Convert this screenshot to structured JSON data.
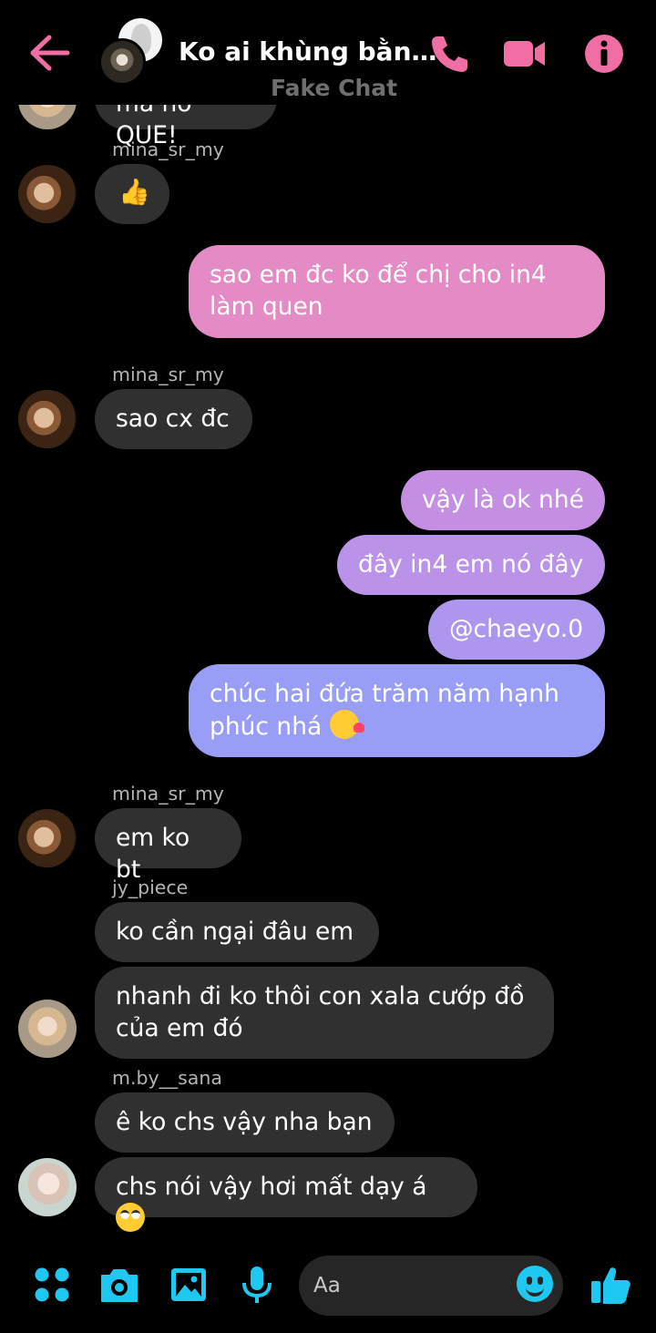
{
  "header": {
    "title": "Ko ai khùng bằn…",
    "subtitle": "Fake Chat",
    "icons": [
      "back-arrow-icon",
      "phone-icon",
      "video-icon",
      "info-icon"
    ],
    "accent_color": "#f06ea4"
  },
  "messages": {
    "clipped_top": "mà nó QUE!",
    "m1_sender": "mina_sr_my",
    "m1_emoji": "👍",
    "m2_text": "sao em đc ko để chị cho in4 làm quen",
    "m3_sender": "mina_sr_my",
    "m3_text": "sao cx đc",
    "m4_text": "vậy là ok nhé",
    "m5_text": "đây in4 em nó đây",
    "m6_text": "@chaeyo.0",
    "m7_text": "chúc hai đứa trăm năm hạnh phúc nhá",
    "m8_sender": "mina_sr_my",
    "m8_text": "em ko bt",
    "m9_sender": "jy_piece",
    "m9_text": "ko cần ngại đâu em",
    "m10_text": "nhanh đi ko thôi con xala cướp đồ của em đó",
    "m11_sender": "m.by__sana",
    "m11_text": "ê ko chs vậy nha bạn",
    "m12_text": "chs nói vậy hơi mất dạy á"
  },
  "composer": {
    "placeholder": "Aa",
    "icons": [
      "menu-dots-icon",
      "camera-icon",
      "image-icon",
      "mic-icon",
      "emoji-icon",
      "like-icon"
    ],
    "accent_color": "#1ec8f0"
  }
}
